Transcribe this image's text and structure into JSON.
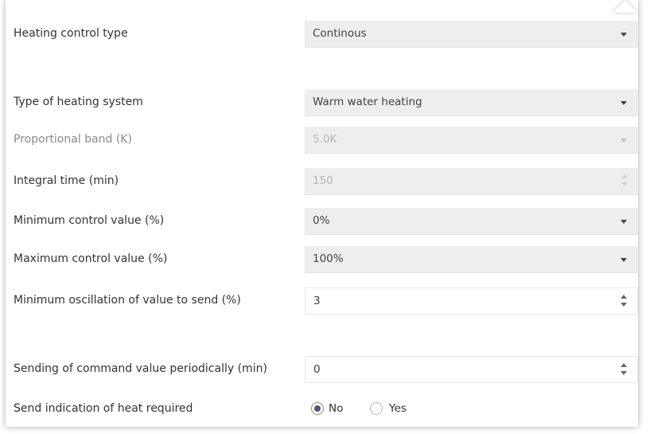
{
  "settings": {
    "heating_control_type": {
      "label": "Heating control type",
      "value": "Continous"
    },
    "type_of_heating_system": {
      "label": "Type of heating system",
      "value": "Warm water heating"
    },
    "proportional_band": {
      "label": "Proportional band (K)",
      "value": "5.0K"
    },
    "integral_time": {
      "label": "Integral time (min)",
      "value": "150"
    },
    "minimum_control_value": {
      "label": "Minimum control value (%)",
      "value": "0%"
    },
    "maximum_control_value": {
      "label": "Maximum control value (%)",
      "value": "100%"
    },
    "minimum_oscillation": {
      "label": "Minimum oscillation of value to send (%)",
      "value": "3"
    },
    "sending_periodically": {
      "label": "Sending of command value periodically (min)",
      "value": "0"
    },
    "send_indication": {
      "label": "Send indication of heat required",
      "options": [
        "No",
        "Yes"
      ],
      "selected": "No"
    }
  },
  "icons": {
    "dropdown": "chevron-down-icon",
    "spinner": "spinner-arrows-icon",
    "radio": "radio-button-icon"
  },
  "colors": {
    "control_background": "#eeeeee",
    "radio_selected": "#4a5a70",
    "disabled_text": "#b5b5b5"
  }
}
